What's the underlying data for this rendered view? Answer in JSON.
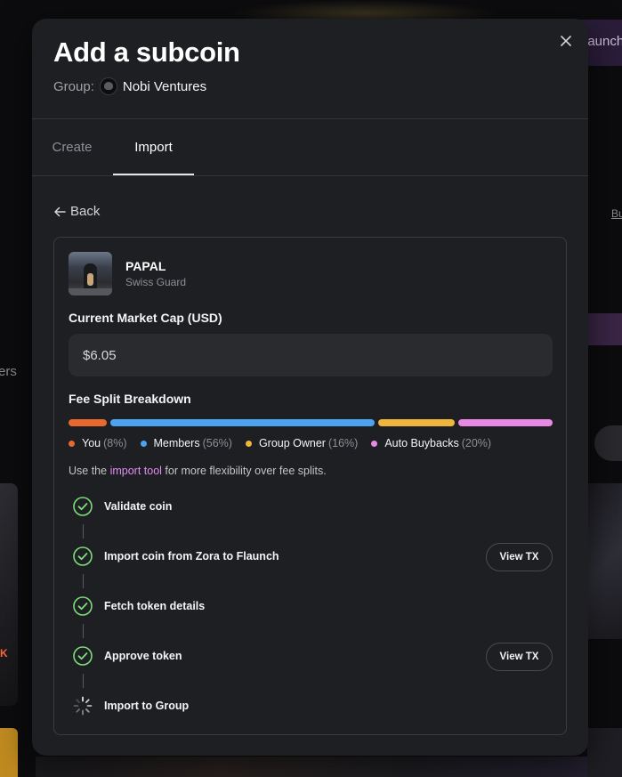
{
  "background": {
    "launch_button_label": "Launch Now",
    "link_text": "Bu",
    "side_text": "ers",
    "left_card_value": "K"
  },
  "modal": {
    "title": "Add a subcoin",
    "group_label": "Group:",
    "group_name": "Nobi Ventures",
    "close_icon": "close-icon"
  },
  "tabs": [
    {
      "label": "Create",
      "active": false
    },
    {
      "label": "Import",
      "active": true
    }
  ],
  "back_label": "Back",
  "coin": {
    "name": "PAPAL",
    "subtitle": "Swiss Guard"
  },
  "market_cap": {
    "label": "Current Market Cap (USD)",
    "value": "$6.05"
  },
  "fee_split": {
    "label": "Fee Split Breakdown",
    "items": [
      {
        "name": "You",
        "pct_text": "(8%)",
        "pct": 8,
        "color": "#e8682e"
      },
      {
        "name": "Members",
        "pct_text": "(56%)",
        "pct": 56,
        "color": "#4da3f0"
      },
      {
        "name": "Group Owner",
        "pct_text": "(16%)",
        "pct": 16,
        "color": "#f0b63c"
      },
      {
        "name": "Auto Buybacks",
        "pct_text": "(20%)",
        "pct": 20,
        "color": "#e889e6"
      }
    ]
  },
  "import_note": {
    "prefix": "Use the ",
    "link": "import tool",
    "suffix": " for more flexibility over fee splits."
  },
  "steps": [
    {
      "label": "Validate coin",
      "status": "done",
      "action": ""
    },
    {
      "label": "Import coin from Zora to Flaunch",
      "status": "done",
      "action": "View TX"
    },
    {
      "label": "Fetch token details",
      "status": "done",
      "action": ""
    },
    {
      "label": "Approve token",
      "status": "done",
      "action": "View TX"
    },
    {
      "label": "Import to Group",
      "status": "loading",
      "action": ""
    }
  ],
  "colors": {
    "accent_link": "#e28ef0",
    "check_green": "#7fdc7a",
    "modal_bg": "#1e1f22"
  }
}
